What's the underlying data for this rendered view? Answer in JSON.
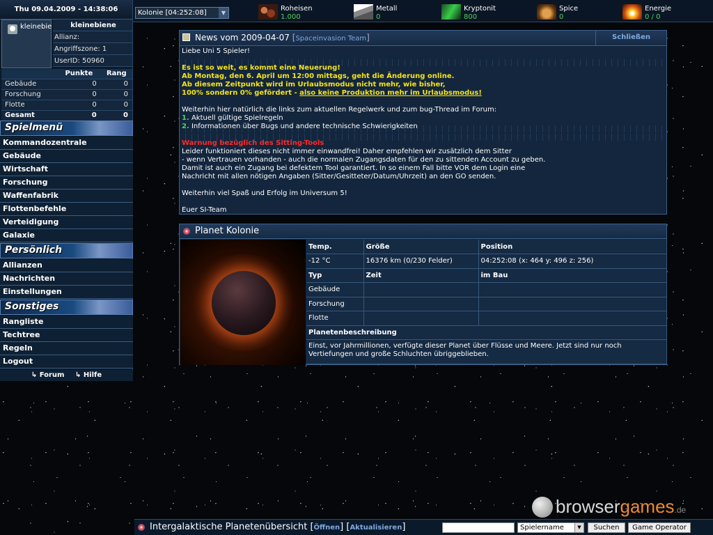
{
  "datetime": "Thu 09.04.2009 - 14:38:06",
  "user": {
    "avatar_label": "kleinebie",
    "name": "kleinebiene",
    "alliance": "Allianz:",
    "attack_zone": "Angriffszone: 1",
    "user_id": "UserID: 50960"
  },
  "stats": {
    "headers": [
      "Punkte",
      "Rang"
    ],
    "rows": [
      {
        "label": "Gebäude",
        "points": "0",
        "rank": "0"
      },
      {
        "label": "Forschung",
        "points": "0",
        "rank": "0"
      },
      {
        "label": "Flotte",
        "points": "0",
        "rank": "0"
      },
      {
        "label": "Gesamt",
        "points": "0",
        "rank": "0"
      }
    ]
  },
  "menus": {
    "spielmenu": {
      "title": "Spielmenü",
      "items": [
        "Kommandozentrale",
        "Gebäude",
        "Wirtschaft",
        "Forschung",
        "Waffenfabrik",
        "Flottenbefehle",
        "Verteidigung",
        "Galaxie"
      ]
    },
    "persoenlich": {
      "title": "Persönlich",
      "items": [
        "Allianzen",
        "Nachrichten",
        "Einstellungen"
      ]
    },
    "sonstiges": {
      "title": "Sonstiges",
      "items": [
        "Rangliste",
        "Techtree",
        "Regeln",
        "Logout"
      ]
    }
  },
  "help_links": {
    "forum": "↳ Forum",
    "help": "↳ Hilfe"
  },
  "colony_select": "Kolonie [04:252:08]",
  "resources": [
    {
      "name": "Roheisen",
      "value": "1.000",
      "icon": "iron-ore-icon"
    },
    {
      "name": "Metall",
      "value": "0",
      "icon": "metal-icon"
    },
    {
      "name": "Kryptonit",
      "value": "800",
      "icon": "kryptonite-icon"
    },
    {
      "name": "Spice",
      "value": "0",
      "icon": "spice-icon"
    },
    {
      "name": "Energie",
      "value": "0 / 0",
      "icon": "energy-icon"
    }
  ],
  "news": {
    "title": "News vom 2009-04-07",
    "source": "Spaceinvasion Team",
    "close": "Schließen",
    "greeting": "Liebe Uni 5 Spieler!",
    "y1": "Es ist so weit, es kommt eine Neuerung!",
    "y2": "Ab Montag, den 6. April um 12:00 mittags, geht die Änderung online.",
    "y3": "Ab diesem Zeitpunkt wird im Urlaubsmodus nicht mehr, wie bisher,",
    "y4a": "100% sondern 0% gefördert - ",
    "y4b": "also keine Produktion mehr im Urlaubsmodus!",
    "links_intro": "Weiterhin hier natürlich die links zum aktuellen Regelwerk und zum bug-Thread im Forum:",
    "link1_num": "1.",
    "link1": "Aktuell gültige Spielregeln",
    "link2_num": "2.",
    "link2": "Informationen über Bugs und andere technische Schwierigkeiten",
    "warn": "Warnung bezüglich des Sitting-Tools",
    "w1": "Leider funktioniert dieses nicht immer einwandfrei! Daher empfehlen wir zusätzlich dem Sitter",
    "w2": "- wenn Vertrauen vorhanden - auch die normalen Zugangsdaten für den zu sittenden Account zu geben.",
    "w3": "Damit ist auch ein Zugang bei defektem Tool garantiert. In so einem Fall bitte VOR dem Login eine",
    "w4": "Nachricht mit allen nötigen Angaben (Sitter/Gesitteter/Datum/Uhrzeit) an den GO senden.",
    "fun": "Weiterhin viel Spaß und Erfolg im Universum 5!",
    "sign": "Euer SI-Team"
  },
  "planet": {
    "title": "Planet Kolonie",
    "h_temp": "Temp.",
    "h_size": "Größe",
    "h_pos": "Position",
    "temp": "-12 °C",
    "size": "16376 km (0/230 Felder)",
    "position": "04:252:08 (x: 464 y: 496 z: 256)",
    "h_type": "Typ",
    "h_time": "Zeit",
    "h_build": "im Bau",
    "r1": "Gebäude",
    "r2": "Forschung",
    "r3": "Flotte",
    "desc_head": "Planetenbeschreibung",
    "desc": "Einst, vor Jahrmillionen, verfügte dieser Planet über Flüsse und Meere. Jetzt sind nur noch Vertiefungen und große Schluchten übriggeblieben."
  },
  "bottom": {
    "title": "Intergalaktische Planetenübersicht",
    "open": "Öffnen",
    "refresh": "Aktualisieren",
    "select": "Spielername",
    "search": "Suchen",
    "operator": "Game Operator"
  },
  "watermark": {
    "a": "browser",
    "b": "games",
    "c": ".de"
  }
}
